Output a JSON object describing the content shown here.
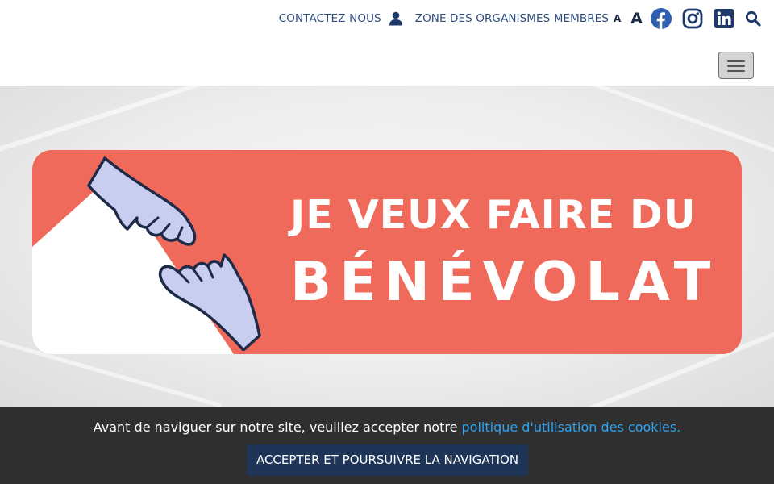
{
  "header": {
    "contact_label": "CONTACTEZ-NOUS",
    "members_label": "ZONE DES ORGANISMES MEMBRES",
    "font_small_label": "A",
    "font_large_label": "A",
    "icons": [
      "user-icon",
      "facebook-icon",
      "instagram-icon",
      "linkedin-icon",
      "search-icon",
      "hamburger-menu-icon"
    ],
    "colors": {
      "link": "#2b4c7e",
      "icon": "#1d3a6b",
      "facebook": "#2f5fb0"
    }
  },
  "hero": {
    "line1": "JE VEUX FAIRE DU",
    "line2": "BÉNÉVOLAT",
    "colors": {
      "banner": "#ef6a5b",
      "hands": "#c9cdf0",
      "outline": "#1d2b48"
    }
  },
  "cookie": {
    "text": "Avant de naviguer sur notre site, veuillez accepter notre ",
    "link_label": "politique d'utilisation des cookies.",
    "button_label": "ACCEPTER ET POURSUIVRE LA NAVIGATION",
    "colors": {
      "bar": "#2f2f2f",
      "link": "#2ea3f2",
      "button": "#1e3557"
    }
  }
}
